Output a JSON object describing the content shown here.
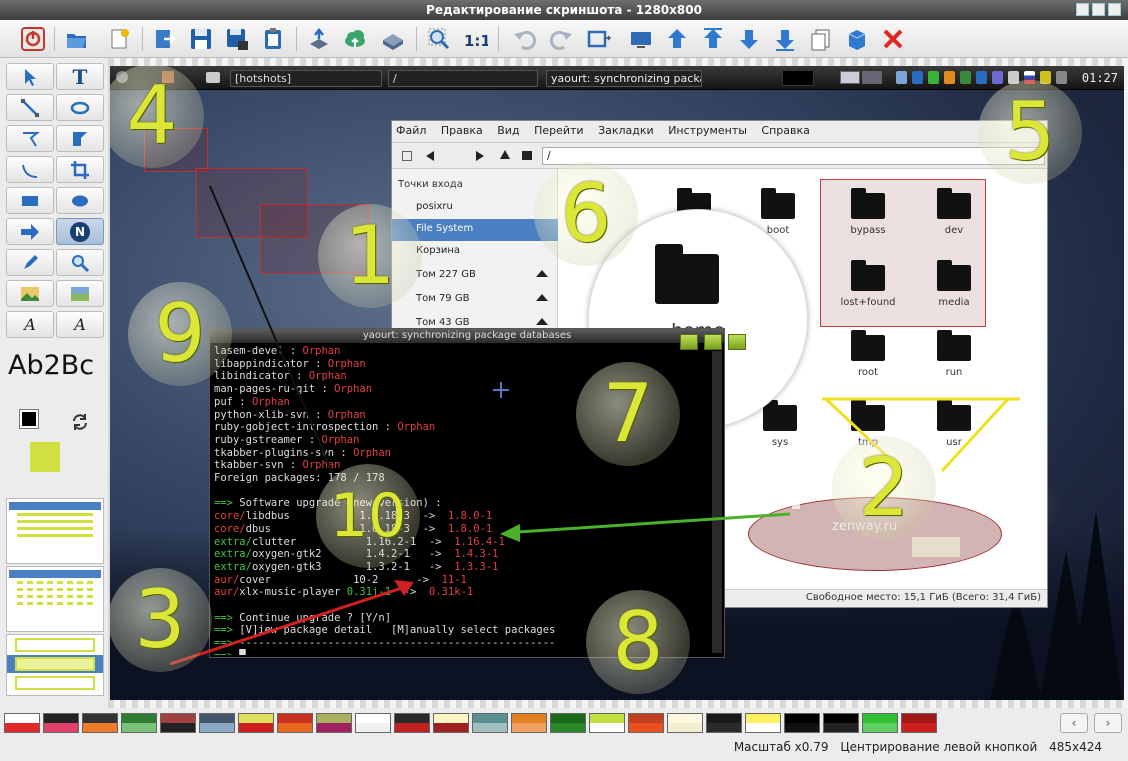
{
  "window": {
    "title": "Редактирование скриншота - 1280x800"
  },
  "toolbar": {
    "items": [
      "restart-icon",
      "open-icon",
      "new-icon",
      "export-icon",
      "save-icon",
      "save-as-icon",
      "clipboard-icon",
      "upload-icon",
      "cloud-upload-icon",
      "print-icon",
      "zoom-icon",
      "actual-size-icon",
      "undo-icon",
      "redo-icon",
      "resize-icon",
      "monitor-icon",
      "bring-front-icon",
      "raise-icon",
      "lower-icon",
      "send-back-icon",
      "copy-icon",
      "box-3d-icon",
      "delete-icon"
    ]
  },
  "tools": {
    "font_preview": "Ab2Bc",
    "names": [
      "select",
      "text",
      "line",
      "ellipse-outline",
      "polygon",
      "fill-shape",
      "curve",
      "crop",
      "rectangle",
      "ellipse",
      "arrow",
      "number",
      "highlighter",
      "magnifier",
      "image",
      "pixelate",
      "text-style-1",
      "text-style-2"
    ],
    "text_label": "T",
    "number_label": "N",
    "text_style_label": "A"
  },
  "screenshot": {
    "panel": {
      "tasks": [
        "[hotshots]",
        "/",
        "yaourt: synchronizing packag..."
      ],
      "clock": "01:27"
    },
    "file_manager": {
      "menu": [
        "Файл",
        "Правка",
        "Вид",
        "Перейти",
        "Закладки",
        "Инструменты",
        "Справка"
      ],
      "address": "/",
      "sidebar_header": "Точки входа",
      "sidebar": [
        "posixru",
        "File System",
        "Корзина",
        "Том 227 GB",
        "Том 79 GB",
        "Том 43 GB"
      ],
      "folders": [
        "bin",
        "boot",
        "bypass",
        "dev",
        "home",
        "lost+found",
        "media",
        "root",
        "run",
        "sys",
        "tmp",
        "usr"
      ],
      "status": "Свободное место: 15,1 ГиБ (Всего: 31,4 ГиБ)",
      "watermark": "zenway.ru"
    },
    "terminal": {
      "title": "yaourt: synchronizing package databases",
      "lines": [
        [
          [
            "lasem-devel : ",
            "wht"
          ],
          [
            "Orphan",
            "red"
          ]
        ],
        [
          [
            "libappindicator : ",
            "wht"
          ],
          [
            "Orphan",
            "red"
          ]
        ],
        [
          [
            "libindicator : ",
            "wht"
          ],
          [
            "Orphan",
            "red"
          ]
        ],
        [
          [
            "man-pages-ru-git : ",
            "wht"
          ],
          [
            "Orphan",
            "red"
          ]
        ],
        [
          [
            "puf : ",
            "wht"
          ],
          [
            "Orphan",
            "red"
          ]
        ],
        [
          [
            "python-xlib-svn : ",
            "wht"
          ],
          [
            "Orphan",
            "red"
          ]
        ],
        [
          [
            "ruby-gobject-introspection : ",
            "wht"
          ],
          [
            "Orphan",
            "red"
          ]
        ],
        [
          [
            "ruby-gstreamer : ",
            "wht"
          ],
          [
            "Orphan",
            "red"
          ]
        ],
        [
          [
            "tkabber-plugins-svn : ",
            "wht"
          ],
          [
            "Orphan",
            "red"
          ]
        ],
        [
          [
            "tkabber-svn : ",
            "wht"
          ],
          [
            "Orphan",
            "red"
          ]
        ],
        [
          [
            "Foreign packages: 178 / 178",
            "wht"
          ]
        ],
        [
          [
            "",
            ""
          ]
        ],
        [
          [
            "==> ",
            "grn"
          ],
          [
            "Software upgrade (new version) :",
            "wht"
          ]
        ],
        [
          [
            "core/",
            "red"
          ],
          [
            "libdbus           1.6.18-3  ->  ",
            "wht"
          ],
          [
            "1.8.0-1",
            "red"
          ]
        ],
        [
          [
            "core/",
            "red"
          ],
          [
            "dbus              1.6.18-3  ->  ",
            "wht"
          ],
          [
            "1.8.0-1",
            "red"
          ]
        ],
        [
          [
            "extra/",
            "grn"
          ],
          [
            "clutter           1.16.2-1  ->  ",
            "wht"
          ],
          [
            "1.16.4-1",
            "red"
          ]
        ],
        [
          [
            "extra/",
            "grn"
          ],
          [
            "oxygen-gtk2       1.4.2-1   ->  ",
            "wht"
          ],
          [
            "1.4.3-1",
            "red"
          ]
        ],
        [
          [
            "extra/",
            "grn"
          ],
          [
            "oxygen-gtk3       1.3.2-1   ->  ",
            "wht"
          ],
          [
            "1.3.3-1",
            "red"
          ]
        ],
        [
          [
            "aur/",
            "red"
          ],
          [
            "cover             10-2      ->  ",
            "wht"
          ],
          [
            "11-1",
            "red"
          ]
        ],
        [
          [
            "aur/",
            "red"
          ],
          [
            "xlx-music-player ",
            "wht"
          ],
          [
            "0.31j-1",
            "grn"
          ],
          [
            "  ->  ",
            "wht"
          ],
          [
            "0.31k-1",
            "red"
          ]
        ],
        [
          [
            "",
            ""
          ]
        ],
        [
          [
            "==> ",
            "grn"
          ],
          [
            "Continue upgrade ? [Y/n]",
            "wht"
          ]
        ],
        [
          [
            "==> ",
            "grn"
          ],
          [
            "[V]iew package detail   [M]anually select packages",
            "wht"
          ]
        ],
        [
          [
            "==> ",
            "grn"
          ],
          [
            "--------------------------------------------------",
            "wht"
          ]
        ],
        [
          [
            "==> ",
            "grn"
          ],
          [
            "█",
            "wht"
          ]
        ]
      ]
    },
    "numbers": [
      "1",
      "2",
      "3",
      "4",
      "5",
      "6",
      "7",
      "8",
      "9",
      "10"
    ]
  },
  "palette": {
    "colors": [
      "#ffffff",
      "#e02828",
      "#222222",
      "#e0406a",
      "#333333",
      "#ef7b2a",
      "#2e7d32",
      "#7ac27a",
      "#a04040",
      "#222222",
      "#44556a",
      "#8aa8c8",
      "#e0e060",
      "#c82020",
      "#c83020",
      "#e86820",
      "#a8b060",
      "#a02060",
      "#ffffff",
      "#f0f0f0",
      "#2a2a2a",
      "#c02020",
      "#fdf6c0",
      "#a02020",
      "#5a9090",
      "#a0c0c0",
      "#e08020",
      "#f0a060",
      "#1a6a1a",
      "#2a8a2a",
      "#c0e040",
      "#ffffff",
      "#c04020",
      "#e85020",
      "#fff8e0",
      "#f0f0d0",
      "#1a1a1a",
      "#2a2a2a",
      "#fff060",
      "#ffffff",
      "#000000",
      "#111111",
      "#000000",
      "#222222",
      "#30c030",
      "#60d060",
      "#a01818",
      "#cc2020"
    ]
  },
  "status": {
    "zoom": "Масштаб x0.79",
    "hint": "Центрирование левой кнопкой",
    "size": "485x424"
  }
}
